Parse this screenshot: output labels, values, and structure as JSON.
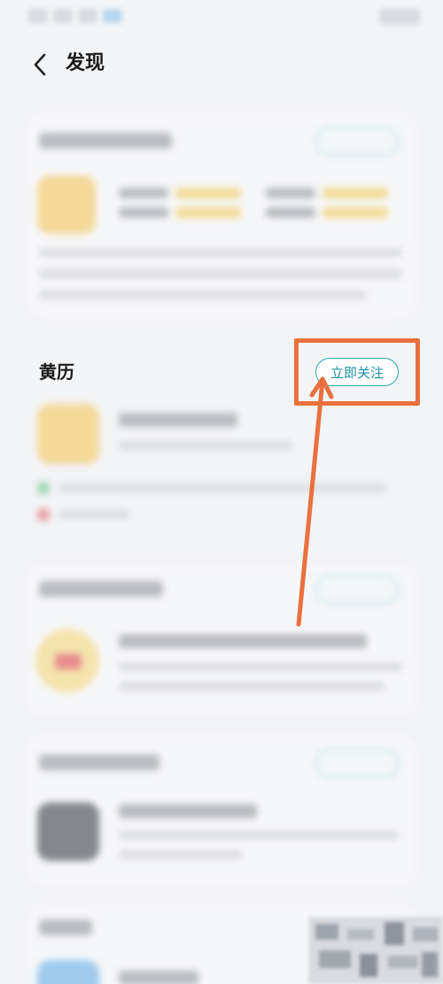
{
  "header": {
    "title": "发现"
  },
  "sections": [
    {
      "id": "blurred-top",
      "follow_label": ""
    },
    {
      "id": "huangli",
      "title": "黄历",
      "follow_label": "立即关注"
    },
    {
      "id": "blurred-mid",
      "follow_label": ""
    },
    {
      "id": "blurred-lower",
      "follow_label": ""
    },
    {
      "id": "blurred-bottom",
      "follow_label": ""
    }
  ],
  "icons": {
    "back": "chevron-left-icon",
    "arrow": "annotation-arrow"
  },
  "colors": {
    "accent": "#2aa7b8",
    "annotation": "#e8713e",
    "background": "#f3f4f6",
    "card": "#fafafb",
    "yellow_icon": "#f6c44d"
  }
}
